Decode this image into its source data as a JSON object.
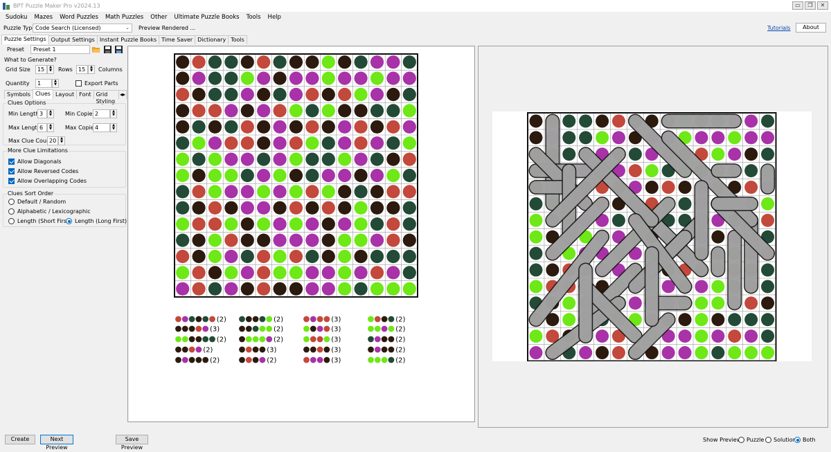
{
  "window": {
    "title": "BPT Puzzle Maker Pro v2024.13"
  },
  "menu": [
    "Sudoku",
    "Mazes",
    "Word Puzzles",
    "Math Puzzles",
    "Other",
    "Ultimate Puzzle Books",
    "Tools",
    "Help"
  ],
  "puzzle_type": {
    "label": "Puzzle Type",
    "value": "Code Search (Licensed)",
    "status": "Preview Rendered ..."
  },
  "links": {
    "tutorials": "Tutorials",
    "about": "About"
  },
  "main_tabs": [
    "Puzzle Settings",
    "Output Settings",
    "Instant Puzzle Books",
    "Time Saver",
    "Dictionary",
    "Tools"
  ],
  "preset": {
    "label": "Preset",
    "value": "Preset 1"
  },
  "generate": {
    "title": "What to Generate?",
    "grid_size_label": "Grid Size",
    "rows": "15",
    "rows_label": "Rows",
    "columns": "15",
    "columns_label": "Columns",
    "quantity_label": "Quantity",
    "quantity": "1",
    "export_parts": "Export Parts"
  },
  "sub_tabs": [
    "Symbols",
    "Clues",
    "Layout",
    "Font",
    "Grid Styling"
  ],
  "clues_options": {
    "title": "Clues Options",
    "min_length_label": "Min Length",
    "min_length": "3",
    "min_copies_label": "Min Copies",
    "min_copies": "2",
    "max_length_label": "Max Length",
    "max_length": "6",
    "max_copies_label": "Max Copies",
    "max_copies": "4",
    "max_clue_label": "Max Clue Count",
    "max_clue": "20"
  },
  "limitations": {
    "title": "More Clue Limitations",
    "diagonals": "Allow Diagonals",
    "reversed": "Allow Reversed Codes",
    "overlapping": "Allow Overlapping Codes"
  },
  "sort": {
    "title": "Clues Sort Order",
    "default": "Default / Random",
    "alpha": "Alphabetic / Lexicographic",
    "short": "Length (Short First)",
    "long": "Length (Long First)"
  },
  "bottom": {
    "create": "Create",
    "next": "Next Preview",
    "save": "Save Preview",
    "show_label": "Show Preview:",
    "puzzle": "Puzzle",
    "solution": "Solution",
    "both": "Both"
  },
  "colors": {
    "dk": "#2c1a0e",
    "gr": "#234a36",
    "rd": "#c2493b",
    "pu": "#a832a8",
    "lg": "#6ee816"
  },
  "grid": [
    [
      "dk",
      "rd",
      "gr",
      "gr",
      "dk",
      "rd",
      "gr",
      "dk",
      "dk",
      "lg",
      "dk",
      "gr",
      "pu",
      "pu",
      "gr"
    ],
    [
      "dk",
      "pu",
      "gr",
      "gr",
      "lg",
      "pu",
      "dk",
      "pu",
      "pu",
      "lg",
      "pu",
      "pu",
      "lg",
      "pu",
      "pu"
    ],
    [
      "rd",
      "dk",
      "gr",
      "gr",
      "pu",
      "dk",
      "gr",
      "pu",
      "rd",
      "dk",
      "rd",
      "lg",
      "pu",
      "dk",
      "gr"
    ],
    [
      "dk",
      "rd",
      "rd",
      "pu",
      "dk",
      "pu",
      "rd",
      "lg",
      "gr",
      "lg",
      "dk",
      "dk",
      "gr",
      "gr",
      "lg"
    ],
    [
      "dk",
      "gr",
      "dk",
      "gr",
      "rd",
      "dk",
      "pu",
      "dk",
      "rd",
      "dk",
      "pu",
      "rd",
      "dk",
      "rd",
      "pu"
    ],
    [
      "gr",
      "lg",
      "pu",
      "rd",
      "rd",
      "dk",
      "pu",
      "rd",
      "lg",
      "gr",
      "pu",
      "rd",
      "pu",
      "gr",
      "lg"
    ],
    [
      "lg",
      "gr",
      "lg",
      "pu",
      "pu",
      "gr",
      "pu",
      "lg",
      "gr",
      "gr",
      "lg",
      "pu",
      "gr",
      "dk",
      "rd"
    ],
    [
      "lg",
      "dk",
      "lg",
      "lg",
      "gr",
      "pu",
      "lg",
      "dk",
      "gr",
      "pu",
      "pu",
      "dk",
      "pu",
      "lg",
      "gr"
    ],
    [
      "gr",
      "rd",
      "lg",
      "pu",
      "pu",
      "lg",
      "pu",
      "lg",
      "rd",
      "lg",
      "dk",
      "gr",
      "dk",
      "rd",
      "rd"
    ],
    [
      "gr",
      "dk",
      "rd",
      "dk",
      "pu",
      "pu",
      "dk",
      "rd",
      "dk",
      "rd",
      "dk",
      "lg",
      "dk",
      "dk",
      "gr"
    ],
    [
      "lg",
      "rd",
      "rd",
      "lg",
      "dk",
      "lg",
      "pu",
      "lg",
      "pu",
      "dk",
      "pu",
      "lg",
      "gr",
      "rd",
      "gr"
    ],
    [
      "gr",
      "dk",
      "lg",
      "rd",
      "dk",
      "dk",
      "pu",
      "pu",
      "pu",
      "dk",
      "lg",
      "lg",
      "pu",
      "rd",
      "dk"
    ],
    [
      "rd",
      "dk",
      "lg",
      "pu",
      "gr",
      "rd",
      "lg",
      "rd",
      "gr",
      "dk",
      "lg",
      "dk",
      "gr",
      "gr",
      "gr"
    ],
    [
      "lg",
      "rd",
      "dk",
      "lg",
      "pu",
      "rd",
      "lg",
      "lg",
      "pu",
      "pu",
      "lg",
      "pu",
      "rd",
      "pu",
      "gr"
    ],
    [
      "pu",
      "rd",
      "gr",
      "pu",
      "dk",
      "rd",
      "dk",
      "dk",
      "pu",
      "pu",
      "lg",
      "gr",
      "lg",
      "lg",
      "lg"
    ]
  ],
  "clues": [
    [
      "rd",
      "pu",
      "gr",
      "dk",
      "gr",
      "rd"
    ],
    [
      "gr",
      "dk",
      "dk",
      "gr",
      "lg"
    ],
    [
      "rd",
      "pu",
      "rd",
      "rd"
    ],
    [
      "lg",
      "rd",
      "dk",
      "gr"
    ],
    [
      "dk",
      "dk",
      "dk",
      "rd",
      "pu"
    ],
    [
      "dk",
      "dk",
      "gr",
      "lg",
      "lg"
    ],
    [
      "lg",
      "dk",
      "pu",
      "rd"
    ],
    [
      "lg",
      "lg",
      "pu",
      "lg"
    ],
    [
      "lg",
      "lg",
      "dk",
      "dk",
      "gr",
      "gr"
    ],
    [
      "dk",
      "lg",
      "lg",
      "lg",
      "pu"
    ],
    [
      "lg",
      "rd",
      "rd",
      "lg"
    ],
    [
      "gr",
      "pu",
      "dk",
      "dk"
    ],
    [
      "dk",
      "dk",
      "rd",
      "pu"
    ],
    [
      "dk",
      "rd",
      "dk",
      "dk"
    ],
    [
      "dk",
      "dk",
      "rd",
      "dk"
    ],
    [
      "dk",
      "pu",
      "dk",
      "dk"
    ],
    [
      "dk",
      "pu",
      "dk",
      "dk",
      "dk"
    ],
    [
      "dk",
      "rd",
      "dk",
      "pu"
    ],
    [
      "rd",
      "pu",
      "pu",
      "dk"
    ],
    [
      "lg",
      "lg",
      "lg",
      "gr"
    ]
  ],
  "clue_counts": [
    "(2)",
    "(2)",
    "(3)",
    "(2)",
    "(3)",
    "(2)",
    "(3)",
    "(2)",
    "(2)",
    "(2)",
    "(3)",
    "(2)",
    "(2)",
    "(3)",
    "(3)",
    "(2)",
    "(2)",
    "(2)",
    "(3)",
    "(2)"
  ],
  "solution_paths": [
    [
      [
        0,
        1
      ],
      [
        5,
        1
      ]
    ],
    [
      [
        3,
        0
      ],
      [
        3,
        3
      ]
    ],
    [
      [
        0,
        6
      ],
      [
        3,
        9
      ]
    ],
    [
      [
        5,
        6
      ],
      [
        9,
        10
      ]
    ],
    [
      [
        6,
        13
      ],
      [
        10,
        13
      ]
    ],
    [
      [
        11,
        7
      ],
      [
        11,
        9
      ]
    ],
    [
      [
        7,
        12
      ],
      [
        11,
        12
      ]
    ],
    [
      [
        3,
        14
      ],
      [
        4,
        14
      ]
    ],
    [
      [
        1,
        8
      ],
      [
        6,
        13
      ]
    ],
    [
      [
        2,
        0
      ],
      [
        5,
        3
      ]
    ],
    [
      [
        4,
        0
      ],
      [
        4,
        2
      ]
    ],
    [
      [
        3,
        2
      ],
      [
        7,
        2
      ]
    ],
    [
      [
        5,
        8
      ],
      [
        9,
        4
      ]
    ],
    [
      [
        2,
        3
      ],
      [
        6,
        7
      ]
    ],
    [
      [
        2,
        5
      ],
      [
        6,
        1
      ]
    ],
    [
      [
        5,
        4
      ],
      [
        8,
        1
      ]
    ],
    [
      [
        7,
        4
      ],
      [
        12,
        0
      ]
    ],
    [
      [
        9,
        6
      ],
      [
        12,
        3
      ]
    ],
    [
      [
        11,
        5
      ],
      [
        14,
        1
      ]
    ],
    [
      [
        6,
        10
      ],
      [
        10,
        6
      ]
    ],
    [
      [
        10,
        3
      ],
      [
        13,
        6
      ]
    ],
    [
      [
        7,
        9
      ],
      [
        9,
        7
      ]
    ],
    [
      [
        6,
        6
      ],
      [
        10,
        9
      ]
    ],
    [
      [
        9,
        3
      ],
      [
        13,
        3
      ]
    ],
    [
      [
        12,
        8
      ],
      [
        14,
        6
      ]
    ],
    [
      [
        8,
        11
      ],
      [
        9,
        11
      ]
    ],
    [
      [
        5,
        11
      ],
      [
        8,
        14
      ]
    ],
    [
      [
        3,
        12
      ],
      [
        3,
        11
      ]
    ],
    [
      [
        8,
        7
      ],
      [
        12,
        7
      ]
    ],
    [
      [
        4,
        10
      ],
      [
        8,
        10
      ]
    ],
    [
      [
        5,
        13
      ],
      [
        5,
        11
      ]
    ],
    [
      [
        0,
        8
      ],
      [
        0,
        12
      ]
    ]
  ]
}
